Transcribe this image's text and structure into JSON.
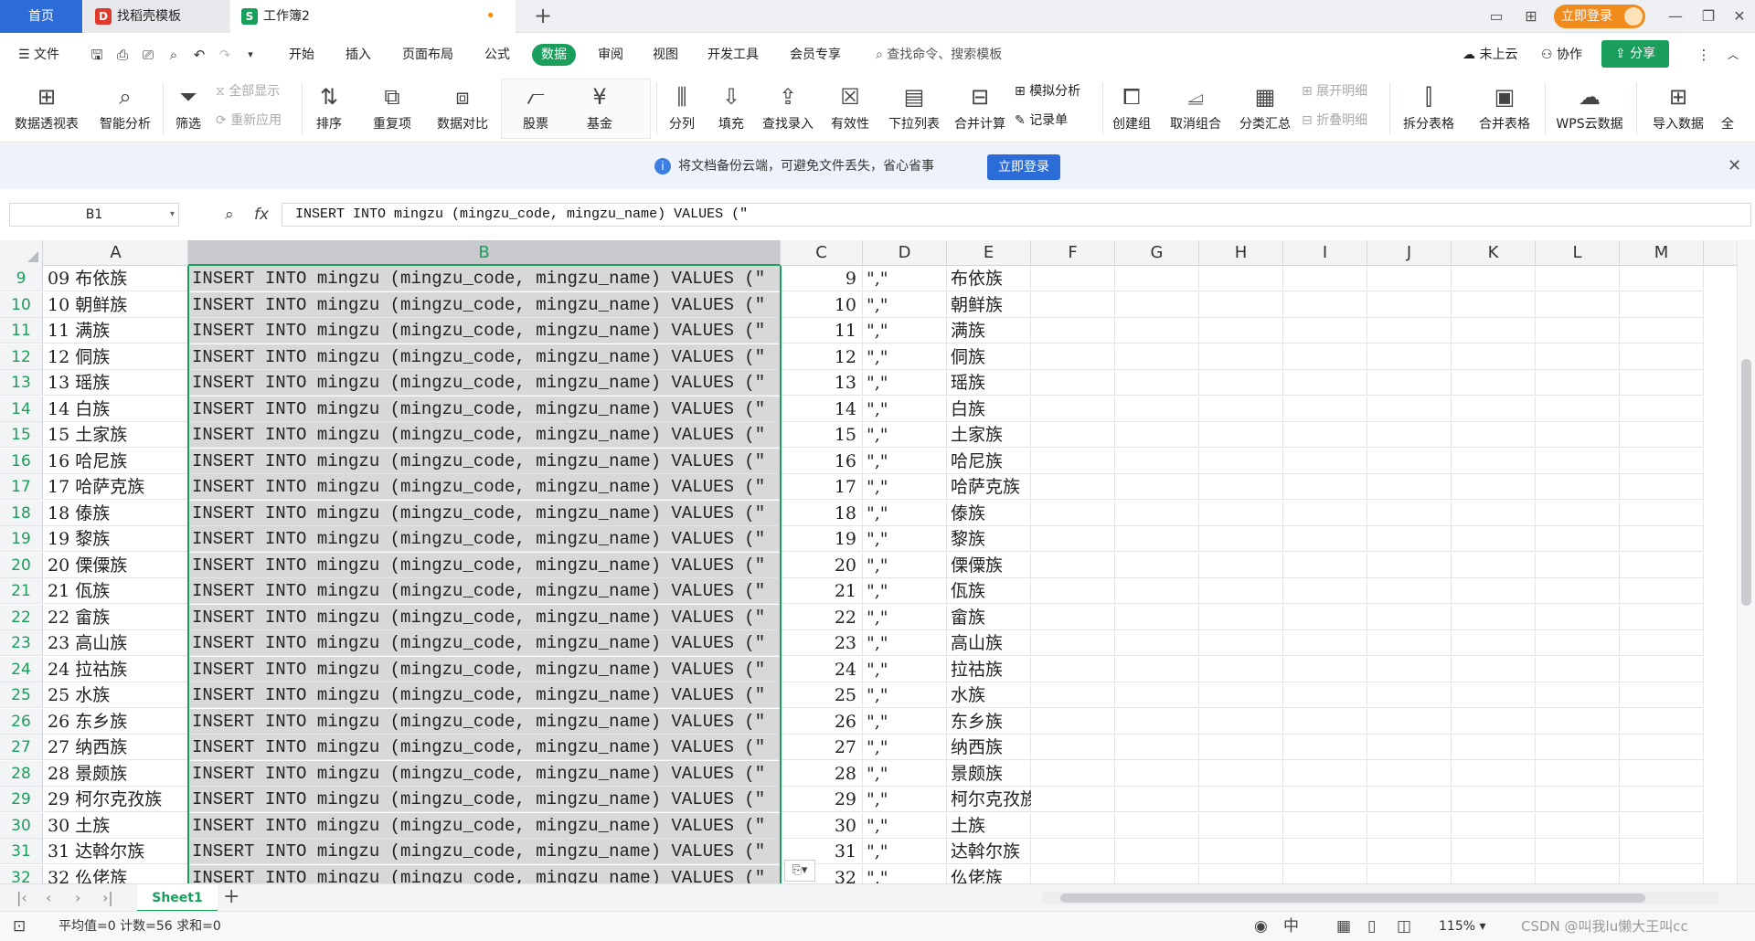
{
  "tabs": {
    "home": "首页",
    "template": "找稻壳模板",
    "workbook": "工作簿2",
    "modified_dot": "•",
    "add": "+"
  },
  "titlebar": {
    "login_button": "立即登录",
    "minimize": "—",
    "restore": "❐",
    "close": "✕"
  },
  "menubar": {
    "file": "文件",
    "items": [
      "开始",
      "插入",
      "页面布局",
      "公式",
      "数据",
      "审阅",
      "视图",
      "开发工具",
      "会员专享"
    ],
    "active_index": 4,
    "search": "查找命令、搜索模板",
    "cloud": "未上云",
    "collab": "协作",
    "share": "分享"
  },
  "ribbon": {
    "pivot": "数据透视表",
    "smart_analysis": "智能分析",
    "filter": "筛选",
    "show_all": "全部显示",
    "reapply": "重新应用",
    "sort": "排序",
    "duplicates": "重复项",
    "compare": "数据对比",
    "stock": "股票",
    "fund": "基金",
    "split": "分列",
    "fill": "填充",
    "lookup": "查找录入",
    "validity": "有效性",
    "dropdown": "下拉列表",
    "consolidate": "合并计算",
    "simulate": "模拟分析",
    "record": "记录单",
    "group": "创建组",
    "ungroup": "取消组合",
    "subtotal": "分类汇总",
    "expand": "展开明细",
    "collapse": "折叠明细",
    "split_table": "拆分表格",
    "merge_table": "合并表格",
    "wps_cloud": "WPS云数据",
    "import": "导入数据",
    "all": "全"
  },
  "notice": {
    "text": "将文档备份云端，可避免文件丢失，省心省事",
    "button": "立即登录"
  },
  "formula_bar": {
    "cell_ref": "B1",
    "fx": "fx",
    "formula": "INSERT INTO mingzu (mingzu_code, mingzu_name) VALUES (\""
  },
  "columns": [
    "A",
    "B",
    "C",
    "D",
    "E",
    "F",
    "G",
    "H",
    "I",
    "J",
    "K",
    "L",
    "M"
  ],
  "selected_column": "B",
  "insert_text": "INSERT INTO mingzu (mingzu_code, mingzu_name) VALUES (\"",
  "quote_sep": "\",\"",
  "rows": [
    {
      "n": "9",
      "code": "09",
      "name": "布依族",
      "c": "9"
    },
    {
      "n": "10",
      "code": "10",
      "name": "朝鲜族",
      "c": "10"
    },
    {
      "n": "11",
      "code": "11",
      "name": "满族",
      "c": "11"
    },
    {
      "n": "12",
      "code": "12",
      "name": "侗族",
      "c": "12"
    },
    {
      "n": "13",
      "code": "13",
      "name": "瑶族",
      "c": "13"
    },
    {
      "n": "14",
      "code": "14",
      "name": "白族",
      "c": "14"
    },
    {
      "n": "15",
      "code": "15",
      "name": "土家族",
      "c": "15"
    },
    {
      "n": "16",
      "code": "16",
      "name": "哈尼族",
      "c": "16"
    },
    {
      "n": "17",
      "code": "17",
      "name": "哈萨克族",
      "c": "17"
    },
    {
      "n": "18",
      "code": "18",
      "name": "傣族",
      "c": "18"
    },
    {
      "n": "19",
      "code": "19",
      "name": "黎族",
      "c": "19"
    },
    {
      "n": "20",
      "code": "20",
      "name": "傈僳族",
      "c": "20"
    },
    {
      "n": "21",
      "code": "21",
      "name": "佤族",
      "c": "21"
    },
    {
      "n": "22",
      "code": "22",
      "name": "畲族",
      "c": "22"
    },
    {
      "n": "23",
      "code": "23",
      "name": "高山族",
      "c": "23"
    },
    {
      "n": "24",
      "code": "24",
      "name": "拉祜族",
      "c": "24"
    },
    {
      "n": "25",
      "code": "25",
      "name": "水族",
      "c": "25"
    },
    {
      "n": "26",
      "code": "26",
      "name": "东乡族",
      "c": "26"
    },
    {
      "n": "27",
      "code": "27",
      "name": "纳西族",
      "c": "27"
    },
    {
      "n": "28",
      "code": "28",
      "name": "景颇族",
      "c": "28"
    },
    {
      "n": "29",
      "code": "29",
      "name": "柯尔克孜族",
      "c": "29"
    },
    {
      "n": "30",
      "code": "30",
      "name": "土族",
      "c": "30"
    },
    {
      "n": "31",
      "code": "31",
      "name": "达斡尔族",
      "c": "31"
    },
    {
      "n": "32",
      "code": "32",
      "name": "仫佬族",
      "c": "32"
    }
  ],
  "sheetbar": {
    "sheet_name": "Sheet1",
    "add": "+"
  },
  "statusbar": {
    "stats": "平均值=0  计数=56  求和=0",
    "zoom": "115%",
    "watermark": "CSDN @叫我lu懒大王叫cc"
  },
  "colors": {
    "accent": "#1a9e5b",
    "brand_blue": "#2b6cd8",
    "login_orange": "#f08b1c",
    "selection_gray": "#d8d8d8"
  }
}
